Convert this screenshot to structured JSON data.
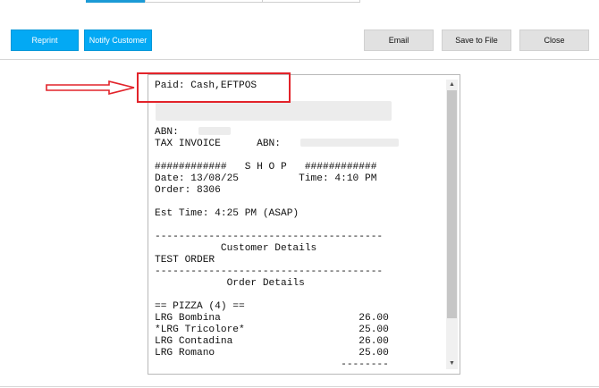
{
  "toolbar": {
    "reprint_label": "Reprint",
    "notify_label": "Notify Customer",
    "email_label": "Email",
    "save_label": "Save to File",
    "close_label": "Close"
  },
  "receipt": {
    "lines": [
      "Paid: Cash,EFTPOS",
      "",
      "",
      "",
      "ABN:",
      "TAX INVOICE      ABN:",
      "",
      "############   S H O P   ############",
      "Date: 13/08/25          Time: 4:10 PM",
      "Order: 8306",
      "",
      "Est Time: 4:25 PM (ASAP)",
      "",
      "--------------------------------------",
      "           Customer Details",
      "TEST ORDER",
      "--------------------------------------",
      "            Order Details",
      "",
      "== PIZZA (4) ==",
      "LRG Bombina                       26.00",
      "*LRG Tricolore*                   25.00",
      "LRG Contadina                     26.00",
      "LRG Romano                        25.00",
      "                               --------"
    ]
  },
  "colors": {
    "primary_button": "#03a9f4",
    "secondary_button": "#e1e1e1",
    "annotation": "#e2232a"
  },
  "icons": {
    "scroll_up": "▲",
    "scroll_down": "▼"
  }
}
